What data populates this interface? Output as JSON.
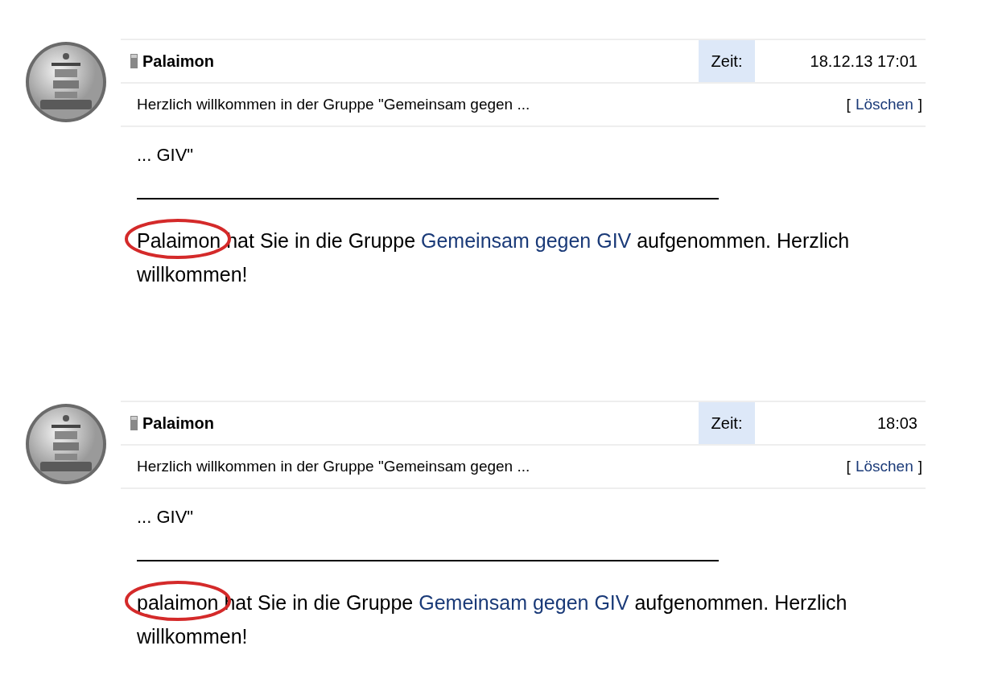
{
  "messages": [
    {
      "author": "Palaimon",
      "time_label": "Zeit:",
      "time": "18.12.13 17:01",
      "subject": "Herzlich willkommen in der Gruppe \"Gemeinsam gegen ...",
      "delete_open": "[",
      "delete_link": "Löschen",
      "delete_close": "]",
      "quote": "... GIV\"",
      "sender": "Palaimon",
      "sender_circled": true,
      "text_mid": " hat Sie in die Gruppe ",
      "group_link": "Gemeinsam gegen GIV",
      "text_end": " aufgenommen. Herzlich willkommen!"
    },
    {
      "author": "Palaimon",
      "time_label": "Zeit:",
      "time": "18:03",
      "subject": "Herzlich willkommen in der Gruppe \"Gemeinsam gegen ...",
      "delete_open": "[",
      "delete_link": "Löschen",
      "delete_close": "]",
      "quote": "... GIV\"",
      "sender": "palaimon",
      "sender_circled": true,
      "text_mid": " hat Sie in die Gruppe ",
      "group_link": "Gemeinsam gegen GIV",
      "text_end": " aufgenommen. Herzlich willkommen!"
    }
  ]
}
